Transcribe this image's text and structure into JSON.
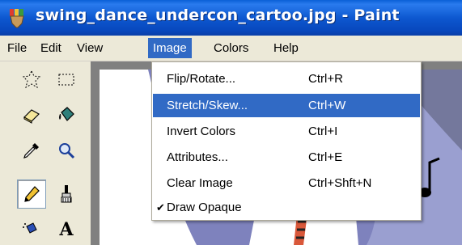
{
  "window": {
    "title": "swing_dance_undercon_cartoo.jpg - Paint",
    "app_icon": "paint-brush-icon"
  },
  "menubar": {
    "items": [
      {
        "label": "File"
      },
      {
        "label": "Edit"
      },
      {
        "label": "View"
      },
      {
        "label": "Image",
        "active": true
      },
      {
        "label": "Colors"
      },
      {
        "label": "Help"
      }
    ]
  },
  "image_menu": {
    "items": [
      {
        "label": "Flip/Rotate...",
        "shortcut": "Ctrl+R"
      },
      {
        "label": "Stretch/Skew...",
        "shortcut": "Ctrl+W",
        "highlighted": true
      },
      {
        "label": "Invert Colors",
        "shortcut": "Ctrl+I"
      },
      {
        "label": "Attributes...",
        "shortcut": "Ctrl+E"
      },
      {
        "label": "Clear Image",
        "shortcut": "Ctrl+Shft+N"
      },
      {
        "label": "Draw Opaque",
        "checked": true,
        "check_mark": "✔"
      }
    ]
  },
  "toolbox": {
    "tools": [
      {
        "name": "free-form-select-icon"
      },
      {
        "name": "rect-select-icon"
      },
      {
        "name": "eraser-icon"
      },
      {
        "name": "fill-bucket-icon"
      },
      {
        "name": "pick-color-icon"
      },
      {
        "name": "magnifier-icon"
      },
      {
        "name": "pencil-icon",
        "pressed": true
      },
      {
        "name": "brush-icon"
      },
      {
        "name": "airbrush-icon"
      },
      {
        "name": "text-icon",
        "glyph": "A"
      }
    ]
  },
  "colors": {
    "titlebar": "#0d58d0",
    "menu_highlight": "#316ac5",
    "chrome": "#ece9d8",
    "canvas_bg": "#808080"
  }
}
